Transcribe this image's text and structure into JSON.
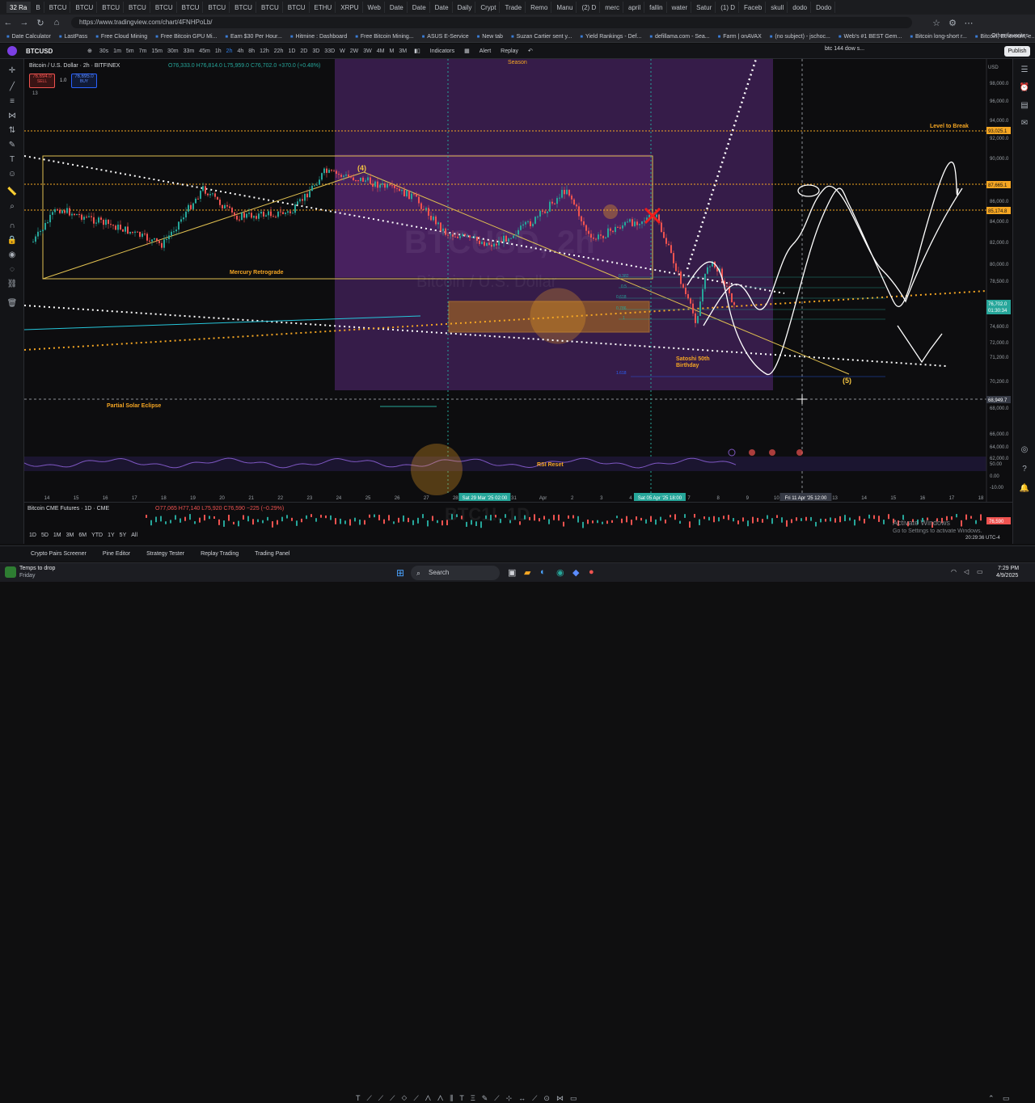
{
  "browser": {
    "tabs": [
      "32 Ra",
      "B",
      "BTCU",
      "BTCU",
      "BTCU",
      "BTCU",
      "BTCU",
      "BTCU",
      "BTCU",
      "BTCU",
      "BTCU",
      "BTCU",
      "ETHU",
      "XRPU",
      "Web",
      "Date",
      "Date",
      "Date",
      "Daily",
      "Crypt",
      "Trade",
      "Remo",
      "Manu",
      "(2) D",
      "merc",
      "april",
      "fallin",
      "water",
      "Satur",
      "(1) D",
      "Faceb",
      "skull",
      "dodo",
      "Dodo"
    ],
    "url": "https://www.tradingview.com/chart/4FNHPoLb/",
    "bookmarks": [
      "Date Calculator",
      "LastPass",
      "Free Cloud Mining",
      "Free Bitcoin GPU Mi...",
      "Earn $30 Per Hour...",
      "Hitmine : Dashboard",
      "Free Bitcoin Mining...",
      "ASUS E-Service",
      "New tab",
      "Suzan Cartier sent y...",
      "Yield Rankings - Def...",
      "defillama.com - Sea...",
      "Farm | onAVAX",
      "(no subject) - jschoc...",
      "Web's #1 BEST Gem...",
      "Bitcoin long-short r...",
      "Bitcoin, Ethereum, e..."
    ],
    "other_favorites": "Other favorites"
  },
  "toolbar": {
    "symbol": "BTCUSD",
    "timeframes": [
      "30s",
      "1m",
      "5m",
      "7m",
      "15m",
      "30m",
      "33m",
      "45m",
      "1h",
      "2h",
      "4h",
      "8h",
      "12h",
      "22h",
      "1D",
      "2D",
      "3D",
      "33D",
      "W",
      "2W",
      "3W",
      "4M",
      "M",
      "3M"
    ],
    "selected_timeframe": "2h",
    "indicators": "Indicators",
    "alert": "Alert",
    "replay": "Replay",
    "layout_name": "btc 144 dow s...",
    "publish": "Publish"
  },
  "legend": {
    "title": "Bitcoin / U.S. Dollar · 2h · BITFINEX",
    "ohlc": "O76,333.0 H76,814.0 L75,959.0 C76,702.0 +370.0 (+0.48%)",
    "sell_price": "76,694.0",
    "sell_label": "SELL",
    "spread": "1.0",
    "buy_price": "76,695.0",
    "buy_label": "BUY",
    "indicator_count": "13",
    "watermark_symbol": "BTCUSD, 2h",
    "watermark_name": "Bitcoin / U.S. Dollar",
    "currency": "USD"
  },
  "annotations": {
    "wave4": "(4)",
    "wave5": "(5)",
    "mercury": "Mercury Retrograde",
    "solar": "Partial Solar Eclipse",
    "satoshi1": "Satoshi 50th",
    "satoshi2": "Birthday",
    "level_break": "Level to Break",
    "rsi_reset": "RSI Reset",
    "season": "Season",
    "fib_0382": "0.382",
    "fib_05": "0.5",
    "fib_0618": "0.618",
    "fib_0786": "0.786",
    "fib_1": "1",
    "fib_1618": "1.618"
  },
  "price_axis": [
    "98,000.0",
    "96,000.0",
    "94,000.0",
    "92,000.0",
    "90,000.0",
    "86,000.0",
    "84,000.0",
    "82,000.0",
    "80,000.0",
    "78,500.0",
    "74,600.0",
    "72,000.0",
    "71,200.0",
    "70,200.0",
    "68,000.0",
    "66,000.0",
    "64,000.0",
    "62,000.0"
  ],
  "price_tags": {
    "level_top": "93,025.1",
    "level_87": "87,665.1",
    "level_85": "85,174.8",
    "current": "76,702.0",
    "countdown": "01:30:34",
    "cursor": "68,949.7"
  },
  "rsi_axis": [
    "50.00",
    "0.00",
    "-10.00"
  ],
  "time_axis": [
    "14",
    "15",
    "16",
    "17",
    "18",
    "19",
    "20",
    "21",
    "22",
    "23",
    "24",
    "25",
    "26",
    "27",
    "28",
    "Sat 29 Mar '25  02:00",
    "31",
    "Apr",
    "2",
    "3",
    "4",
    "Sat 05 Apr '25  18:00",
    "7",
    "8",
    "9",
    "10",
    "Fri 11 Apr '25  12:00",
    "13",
    "14",
    "15",
    "16",
    "17",
    "18"
  ],
  "cme": {
    "title": "Bitcoin CME Futures · 1D · CME",
    "ohlc": "O77,065 H77,140 L75,920 C76,590 −225 (−0.29%)",
    "watermark": "BTC1!, 1D",
    "price_tag": "76,590",
    "range_buttons": [
      "1D",
      "5D",
      "1M",
      "3M",
      "6M",
      "YTD",
      "1Y",
      "5Y",
      "All"
    ],
    "activate_title": "Activate Windows",
    "activate_sub": "Go to Settings to activate Windows.",
    "clock": "20:29:36 UTC-4"
  },
  "bottom_tabs": [
    "Crypto Pairs Screener",
    "Pine Editor",
    "Strategy Tester",
    "Replay Trading",
    "Trading Panel"
  ],
  "taskbar": {
    "weather_title": "Temps to drop",
    "weather_sub": "Friday",
    "search": "Search",
    "time": "7:29 PM",
    "date": "4/9/2025"
  },
  "colors": {
    "up": "#26a69a",
    "down": "#ef5350",
    "accent": "#2962ff",
    "orange": "#f5a623",
    "purple": "#6a2c8a"
  }
}
